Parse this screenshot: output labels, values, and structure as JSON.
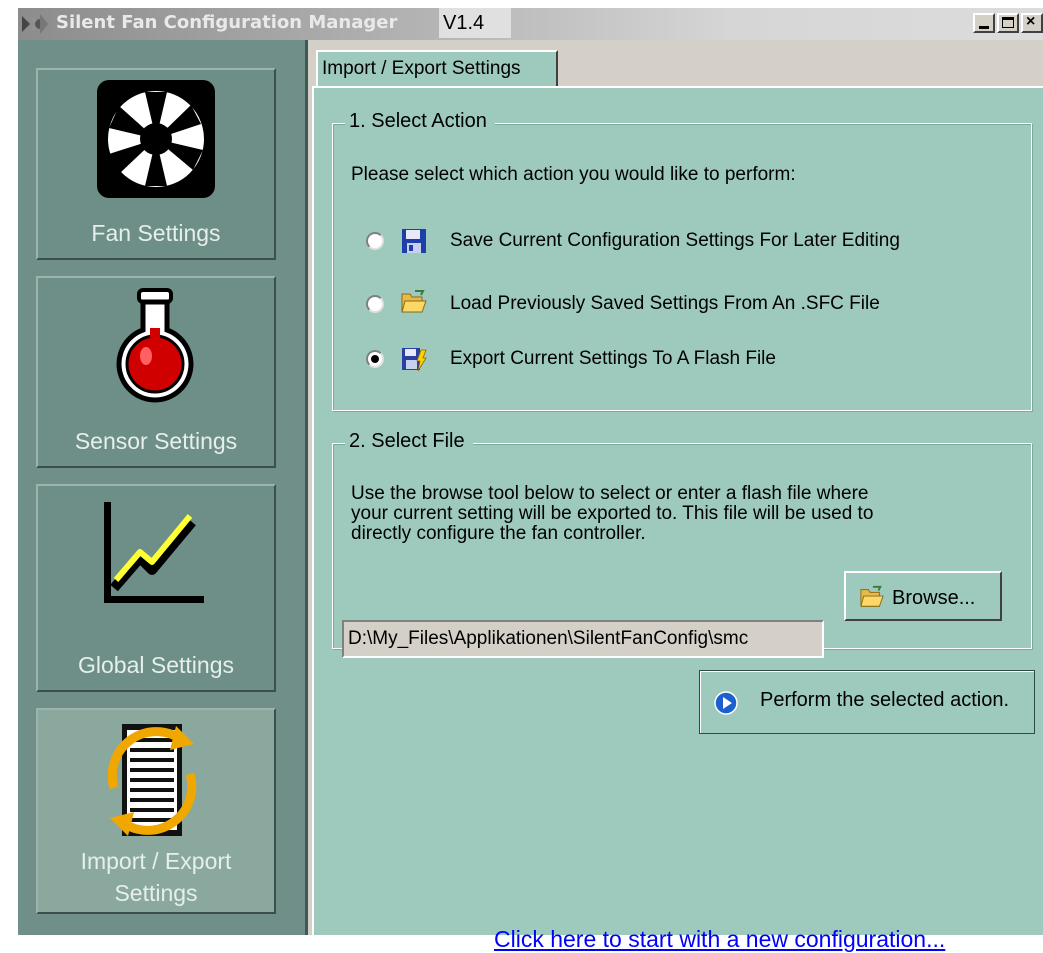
{
  "window": {
    "title": "Silent Fan Configuration Manager",
    "version": "V1.4"
  },
  "sidebar": {
    "items": [
      {
        "label": "Fan Settings",
        "icon": "fan-icon"
      },
      {
        "label": "Sensor Settings",
        "icon": "flask-thermometer-icon"
      },
      {
        "label": "Global Settings",
        "icon": "line-graph-icon"
      },
      {
        "label_line1": "Import / Export",
        "label_line2": "Settings",
        "icon": "import-export-icon",
        "active": true
      }
    ]
  },
  "tabs": [
    {
      "label": "Import / Export Settings",
      "active": true
    }
  ],
  "select_action": {
    "legend": "1.  Select Action",
    "instruction": "Please select which action you would like to perform:",
    "options": [
      {
        "label": "Save Current Configuration Settings For Later Editing",
        "icon": "floppy-save-icon",
        "selected": false
      },
      {
        "label": "Load Previously Saved Settings From An .SFC File",
        "icon": "open-folder-icon",
        "selected": false
      },
      {
        "label": "Export Current Settings To A Flash File",
        "icon": "export-flash-icon",
        "selected": true
      }
    ]
  },
  "select_file": {
    "legend": "2.  Select File",
    "description_line1": "Use the browse tool below to select or enter a flash file where",
    "description_line2": "your current setting will be exported to.  This file will be used to",
    "description_line3": "directly configure the fan controller.",
    "file_path": "D:\\My_Files\\Applikationen\\SilentFanConfig\\smc",
    "browse_label": "Browse..."
  },
  "actions": {
    "perform_label": "Perform the selected action.",
    "new_config_link": "Click here to start with a new configuration..."
  },
  "colors": {
    "panel": "#9ecabe",
    "sidebar": "#6f8f88",
    "link": "#0000ff"
  }
}
